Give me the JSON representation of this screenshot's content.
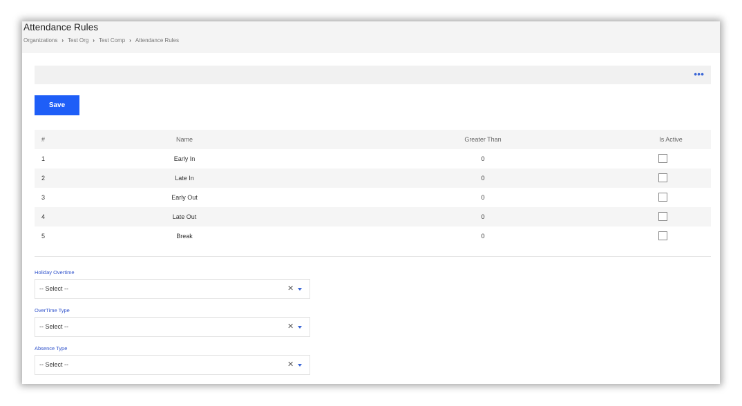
{
  "header": {
    "title": "Attendance Rules",
    "breadcrumb": [
      "Organizations",
      "Test Org",
      "Test Comp",
      "Attendance Rules"
    ]
  },
  "toolbar": {
    "more_icon": "more-horizontal-icon",
    "more_glyph": "•••",
    "save_label": "Save"
  },
  "table": {
    "columns": [
      "#",
      "Name",
      "Greater Than",
      "Is Active"
    ],
    "rows": [
      {
        "num": "1",
        "name": "Early In",
        "greater_than": "0",
        "is_active": false
      },
      {
        "num": "2",
        "name": "Late In",
        "greater_than": "0",
        "is_active": false
      },
      {
        "num": "3",
        "name": "Early Out",
        "greater_than": "0",
        "is_active": false
      },
      {
        "num": "4",
        "name": "Late Out",
        "greater_than": "0",
        "is_active": false
      },
      {
        "num": "5",
        "name": "Break",
        "greater_than": "0",
        "is_active": false
      }
    ]
  },
  "fields": [
    {
      "label": "Holiday Overtime",
      "value": "-- Select --"
    },
    {
      "label": "OverTime Type",
      "value": "-- Select --"
    },
    {
      "label": "Absence Type",
      "value": "-- Select --"
    }
  ],
  "icons": {
    "clear": "close-icon",
    "clear_glyph": "✕",
    "caret": "caret-down-icon"
  },
  "colors": {
    "accent": "#1e5ef7",
    "label": "#3355cc"
  }
}
